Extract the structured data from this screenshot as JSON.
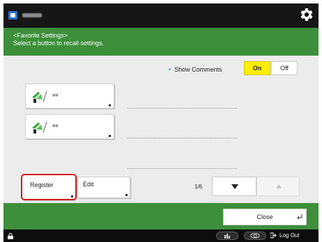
{
  "header": {
    "line1": "<Favorite Settings>",
    "line2": "Select a button to recall settings."
  },
  "comments": {
    "label": "Show Comments",
    "on": "On",
    "off": "Off"
  },
  "favorites": [
    {
      "icon": "copy-setting-icon"
    },
    {
      "icon": "copy-setting-icon"
    }
  ],
  "toolbar": {
    "register": "Register",
    "edit": "Edit",
    "page": "1/6"
  },
  "footer": {
    "close": "Close"
  },
  "status": {
    "logout": "Log Out"
  },
  "colors": {
    "accent_green": "#3e8f3b",
    "toggle_on": "#ffee00",
    "highlight": "#d11b1b"
  }
}
